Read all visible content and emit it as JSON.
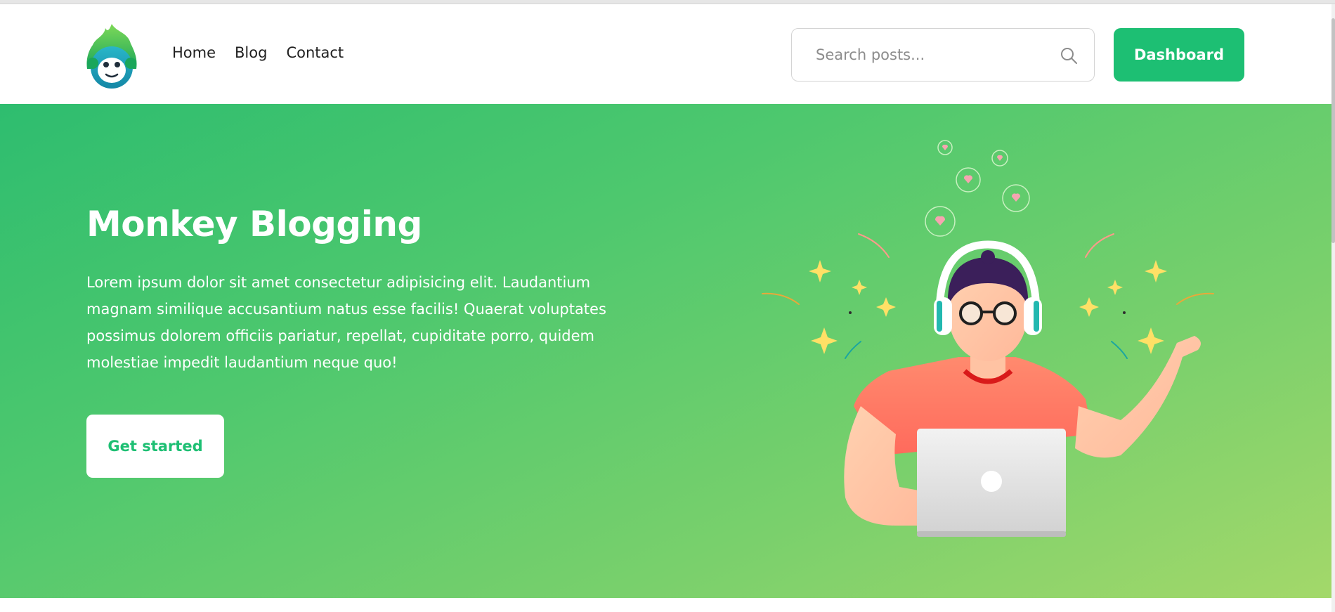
{
  "header": {
    "logo_name": "monkey-leaf-logo",
    "nav": [
      {
        "label": "Home"
      },
      {
        "label": "Blog"
      },
      {
        "label": "Contact"
      }
    ],
    "search": {
      "placeholder": "Search posts...",
      "value": "",
      "icon": "search-icon"
    },
    "dashboard_label": "Dashboard"
  },
  "hero": {
    "title": "Monkey Blogging",
    "description": "Lorem ipsum dolor sit amet consectetur adipisicing elit. Laudantium magnam similique accusantium natus esse facilis! Quaerat voluptates possimus dolorem officiis pariatur, repellat, cupiditate porro, quidem molestiae impedit laudantium neque quo!",
    "cta_label": "Get started",
    "illustration": "person-with-headphones-and-laptop"
  },
  "colors": {
    "brand": "#1dbf73",
    "hero_start": "#2ebd6f",
    "hero_end": "#a3d86a"
  }
}
